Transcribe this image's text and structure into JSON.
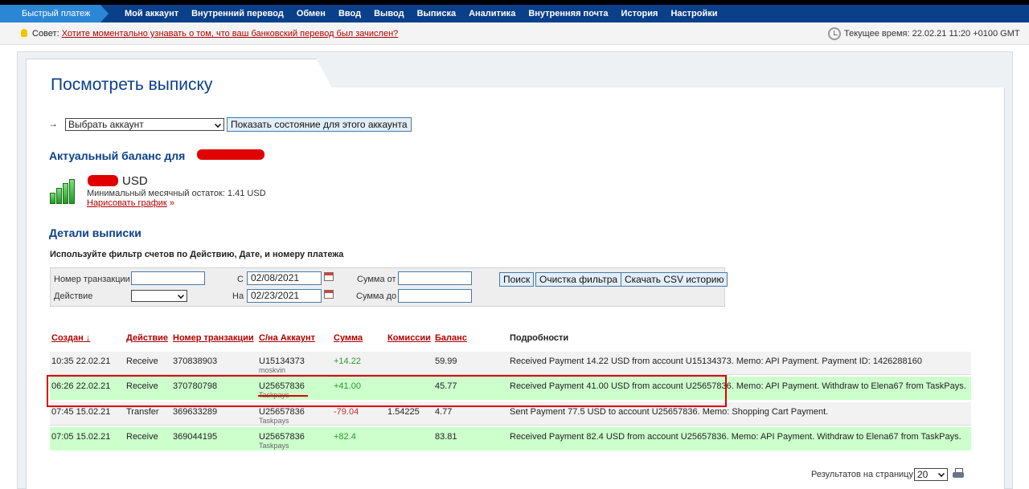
{
  "nav": {
    "fast_payment": "Быстрый платеж",
    "items": [
      "Мой аккаунт",
      "Внутренний перевод",
      "Обмен",
      "Ввод",
      "Вывод",
      "Выписка",
      "Аналитика",
      "Внутренняя почта",
      "История",
      "Настройки"
    ]
  },
  "tipbar": {
    "tip_prefix": "Совет:",
    "tip_link": "Хотите моментально узнавать о том, что ваш банковский перевод был зачислен?",
    "time_label": "Текущее время: 22.02.21 11:20 +0100 GMT"
  },
  "page": {
    "title": "Посмотреть выписку"
  },
  "account_select": {
    "arrow": "→",
    "selected": "Выбрать аккаунт",
    "show_button": "Показать состояние для этого аккаунта"
  },
  "balance": {
    "heading": "Актуальный баланс для",
    "currency": "USD",
    "min_balance": "Минимальный месячный остаток: 1.41 USD",
    "graph_link": "Нарисовать график",
    "graph_suffix": "»"
  },
  "details": {
    "heading": "Детали выписки",
    "hint": "Используйте фильтр счетов по Действию, Дате, и номеру платежа"
  },
  "filter": {
    "txn_label": "Номер транзакции",
    "txn_value": "",
    "action_label": "Действие",
    "from_label": "С",
    "from_value": "02/08/2021",
    "to_label": "На",
    "to_value": "02/23/2021",
    "sum_from_label": "Сумма от",
    "sum_from_value": "",
    "sum_to_label": "Сумма до",
    "sum_to_value": "",
    "search_button": "Поиск",
    "clear_button": "Очистка фильтра",
    "csv_button": "Скачать CSV историю"
  },
  "table": {
    "headers": {
      "created": "Создан ↓",
      "action": "Действие",
      "txn": "Номер транзакции",
      "account": "С/на Аккаунт",
      "amount": "Сумма",
      "fee": "Комиссии",
      "balance": "Баланс",
      "details": "Подробности"
    },
    "rows": [
      {
        "created": "10:35 22.02.21",
        "action": "Receive",
        "txn": "370838903",
        "account": "U15134373",
        "account_sub": "moskvin",
        "amount": "+14.22",
        "fee": "",
        "balance": "59.99",
        "details": "Received Payment 14.22 USD from account U15134373. Memo: API Payment. Payment ID: 1426288160"
      },
      {
        "created": "06:26 22.02.21",
        "action": "Receive",
        "txn": "370780798",
        "account": "U25657836",
        "account_sub": "Taskpays",
        "amount": "+41.00",
        "fee": "",
        "balance": "45.77",
        "details": "Received Payment 41.00 USD from account U25657836. Memo: API Payment. Withdraw to Elena67 from TaskPays."
      },
      {
        "created": "07:45 15.02.21",
        "action": "Transfer",
        "txn": "369633289",
        "account": "U25657836",
        "account_sub": "Taskpays",
        "amount": "-79.04",
        "fee": "1.54225",
        "balance": "4.77",
        "details": "Sent Payment 77.5 USD to account U25657836. Memo: Shopping Cart Payment."
      },
      {
        "created": "07:05 15.02.21",
        "action": "Receive",
        "txn": "369044195",
        "account": "U25657836",
        "account_sub": "Taskpays",
        "amount": "+82.4",
        "fee": "",
        "balance": "83.81",
        "details": "Received Payment 82.4 USD from account U25657836. Memo: API Payment. Withdraw to Elena67 from TaskPays."
      }
    ]
  },
  "pager": {
    "label": "Результатов на страницу:",
    "value": "20"
  }
}
